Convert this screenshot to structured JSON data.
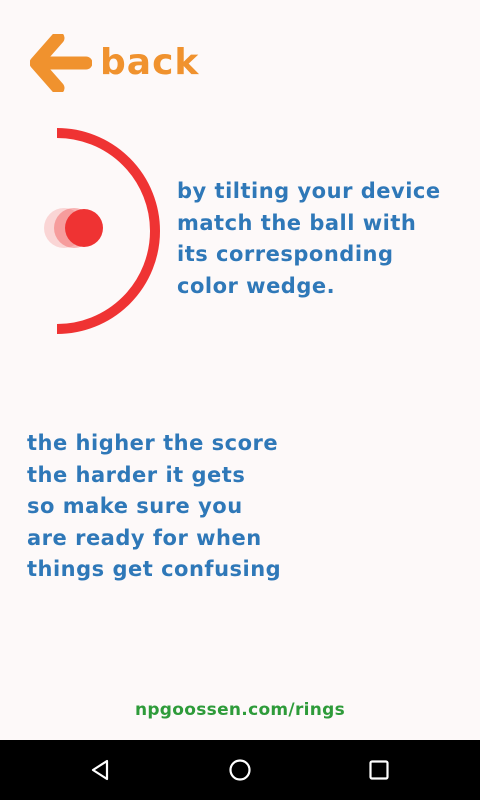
{
  "header": {
    "back_label": "back",
    "icon": "arrow-left-icon"
  },
  "instructions": {
    "lines": [
      "by tilting your device",
      "match the ball with",
      "its corresponding",
      "color wedge."
    ]
  },
  "info": {
    "lines": [
      "the higher the score",
      "the harder it gets",
      "so make sure you",
      "are ready for when",
      "things get confusing"
    ]
  },
  "footer": {
    "link_text": "npgoossen.com/rings"
  },
  "navigation_bar": {
    "back_icon": "triangle-back-icon",
    "home_icon": "circle-home-icon",
    "recents_icon": "square-recents-icon"
  },
  "colors": {
    "background": "#fdf9f9",
    "accent_orange": "#f0922e",
    "text_blue": "#2f78b8",
    "ring_red": "#ef3333",
    "link_green": "#2e9b3a",
    "nav_bar": "#000000"
  }
}
